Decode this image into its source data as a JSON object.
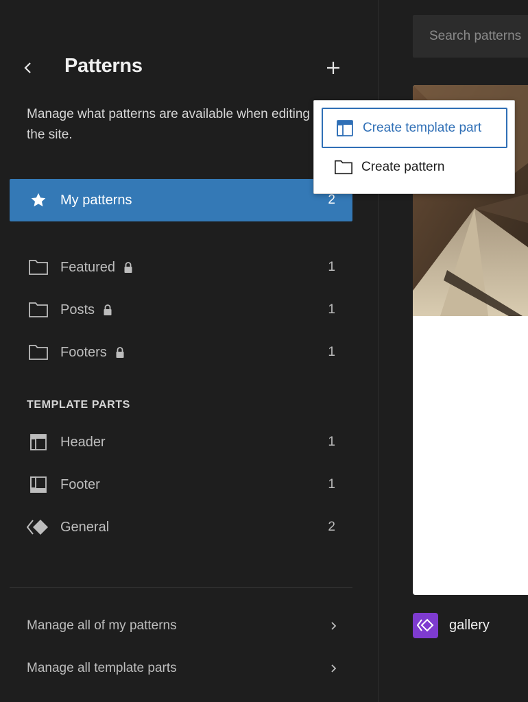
{
  "sidebar": {
    "title": "Patterns",
    "description": "Manage what patterns are available when editing the site.",
    "my_patterns": {
      "label": "My patterns",
      "count": "2"
    },
    "categories": [
      {
        "label": "Featured",
        "count": "1",
        "locked": true
      },
      {
        "label": "Posts",
        "count": "1",
        "locked": true
      },
      {
        "label": "Footers",
        "count": "1",
        "locked": true
      }
    ],
    "template_parts_heading": "TEMPLATE PARTS",
    "template_parts": [
      {
        "label": "Header",
        "count": "1",
        "icon": "header-icon"
      },
      {
        "label": "Footer",
        "count": "1",
        "icon": "footer-icon"
      },
      {
        "label": "General",
        "count": "2",
        "icon": "symbol-icon"
      }
    ],
    "footer_links": [
      {
        "label": "Manage all of my patterns"
      },
      {
        "label": "Manage all template parts"
      }
    ]
  },
  "dropdown": {
    "items": [
      {
        "label": "Create template part",
        "icon": "template-part-icon",
        "focused": true
      },
      {
        "label": "Create pattern",
        "icon": "folder-icon",
        "focused": false
      }
    ]
  },
  "main": {
    "search_placeholder": "Search patterns",
    "card": {
      "label": "gallery",
      "badge_icon": "symbol-icon"
    }
  },
  "colors": {
    "accent": "#3479b6",
    "background": "#1e1e1e",
    "badge": "#7e3bd0"
  }
}
